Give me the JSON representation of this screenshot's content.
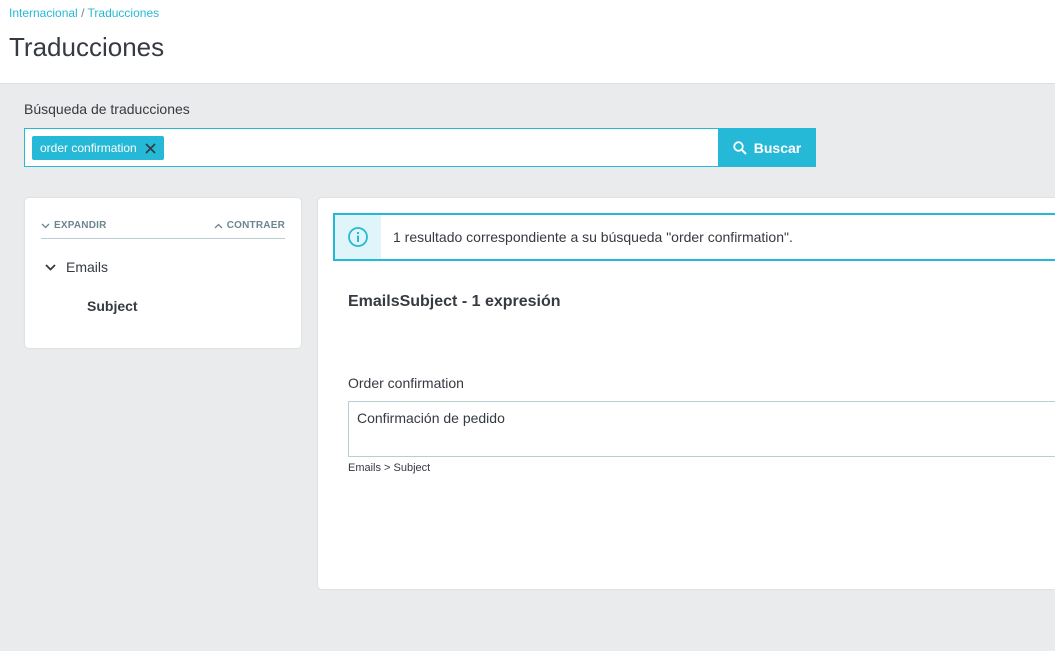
{
  "breadcrumb": {
    "parent": "Internacional",
    "separator": "/",
    "current": "Traducciones"
  },
  "page": {
    "title": "Traducciones"
  },
  "search": {
    "label": "Búsqueda de traducciones",
    "tag": "order confirmation",
    "tag_close_icon": "close-icon",
    "button_label": "Buscar",
    "button_icon": "search-icon"
  },
  "tree": {
    "expand_label": "EXPANDIR",
    "collapse_label": "CONTRAER",
    "folder": {
      "label": "Emails",
      "icon": "chevron-down-icon"
    },
    "leaf": {
      "label": "Subject"
    }
  },
  "results": {
    "alert_icon": "info-icon",
    "alert_text": "1 resultado correspondiente a su búsqueda \"order confirmation\".",
    "domain_title": "EmailsSubject - 1 expresión",
    "field_label": "Order confirmation",
    "field_value": "Confirmación de pedido",
    "field_path": "Emails > Subject"
  },
  "colors": {
    "accent": "#25b9d7",
    "text": "#363a41",
    "muted": "#6c868e",
    "background": "#eaebec"
  }
}
